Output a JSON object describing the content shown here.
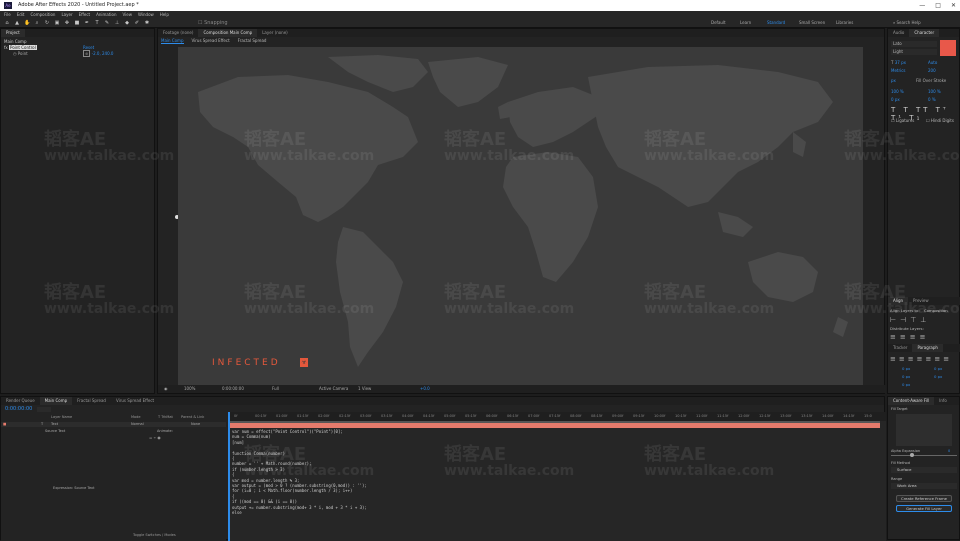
{
  "app": {
    "title": "Adobe After Effects 2020 - Untitled Project.aep *",
    "logo_text": "Ae",
    "window_controls": [
      "—",
      "□",
      "✕"
    ]
  },
  "menu": [
    "File",
    "Edit",
    "Composition",
    "Layer",
    "Effect",
    "Animation",
    "View",
    "Window",
    "Help"
  ],
  "toolbar": {
    "snapping_label": "Snapping",
    "workspaces": [
      "Default",
      "Learn",
      "Standard",
      "Small Screen",
      "Libraries"
    ],
    "active_workspace": "Standard",
    "search_placeholder": "Search Help"
  },
  "project_panel": {
    "tab": "Project",
    "item": "Main Comp",
    "effect_name": "Point Control",
    "property": "Point",
    "value_label": "Reset",
    "value": "-2.0, 240.0"
  },
  "viewer": {
    "tabs": [
      "Footage (none)",
      "Composition Main Comp",
      "Layer (none)"
    ],
    "breadcrumbs": [
      "Main Comp",
      "Virus Spread Effect",
      "Fractal Spread"
    ],
    "logo_text": "INFECTED",
    "logo_icon": "biohazard-icon",
    "zoom": "100%",
    "timecode": "0:00:00:00",
    "resolution": "Full",
    "camera": "Active Camera",
    "views": "1 View",
    "exposure": "+0.0",
    "map_fill": "#4a4a4a",
    "bg": "#3a3a3a"
  },
  "right_panel": {
    "tabs": [
      "Audio",
      "Character"
    ],
    "font": "Lato",
    "style": "Light",
    "font_size": "37 px",
    "leading": "Auto",
    "tracking": "200",
    "kerning": "Metrics",
    "stroke": "px",
    "stroke_mode": "Fill Over Stroke",
    "vscale": "100 %",
    "hscale": "100 %",
    "baseline": "0 px",
    "tsume": "0 %",
    "checks": [
      "Ligatures",
      "Hindi Digits"
    ],
    "swatch_color": "#e8584a",
    "align_tab": "Align",
    "preview_tab": "Preview",
    "align_to_label": "Align Layers to:",
    "align_to_value": "Composition",
    "distribute_label": "Distribute Layers:",
    "paragraph_tabs": [
      "Tracker",
      "Paragraph"
    ],
    "para_values": [
      "0 px",
      "0 px",
      "0 px",
      "0 px",
      "0 px"
    ]
  },
  "timeline": {
    "tabs": [
      "Render Queue",
      "Main Comp",
      "Fractal Spread",
      "Virus Spread Effect"
    ],
    "timecode": "0:00:00:00",
    "columns": [
      "Layer Name",
      "Mode",
      "T TrkMat",
      "Parent & Link"
    ],
    "layer_name": "Text",
    "layer_prop": "Source Text",
    "layer_mode": "Normal",
    "parent": "None",
    "animate_label": "Animate:",
    "expression_label": "Expression: Source Text",
    "toggle_label": "Toggle Switches / Modes",
    "ruler_ticks": [
      "0f",
      "00:15f",
      "01:00f",
      "01:15f",
      "02:00f",
      "02:15f",
      "03:00f",
      "03:15f",
      "04:00f",
      "04:15f",
      "05:00f",
      "05:15f",
      "06:00f",
      "06:15f",
      "07:00f",
      "07:15f",
      "08:00f",
      "08:15f",
      "09:00f",
      "09:15f",
      "10:00f",
      "10:15f",
      "11:00f",
      "11:15f",
      "12:00f",
      "12:15f",
      "13:00f",
      "13:15f",
      "14:00f",
      "14:15f",
      "15:0"
    ],
    "code_lines": [
      "var num = effect(\"Point Control\")(\"Point\")[0];",
      "num = Comma(num)",
      "[num]",
      "",
      "function Comma(number)",
      "{",
      "number = '' + Math.round(number);",
      "if (number.length > 3)",
      "{",
      "var mod = number.length % 3;",
      "var output = (mod > 0 ? (number.substring(0,mod)) : '');",
      "for (i=0 ; i < Math.floor(number.length / 3); i++)",
      "{",
      "if ((mod == 0) && (i == 0))",
      "output += number.substring(mod+ 3 * i, mod + 3 * i + 3);",
      "else"
    ],
    "bar_color": "#e57b6c"
  },
  "fill_panel": {
    "tabs": [
      "Content-Aware Fill",
      "Info"
    ],
    "fill_target_label": "Fill Target",
    "alpha_label": "Alpha Expansion",
    "alpha_value": "0",
    "fill_method_label": "Fill Method",
    "fill_method": "Surface",
    "range_label": "Range",
    "range_value": "Work Area",
    "btn_reference": "Create Reference Frame",
    "btn_generate": "Generate Fill Layer"
  },
  "watermarks": {
    "cn": "韬客AE",
    "url": "www.talkae.com"
  }
}
